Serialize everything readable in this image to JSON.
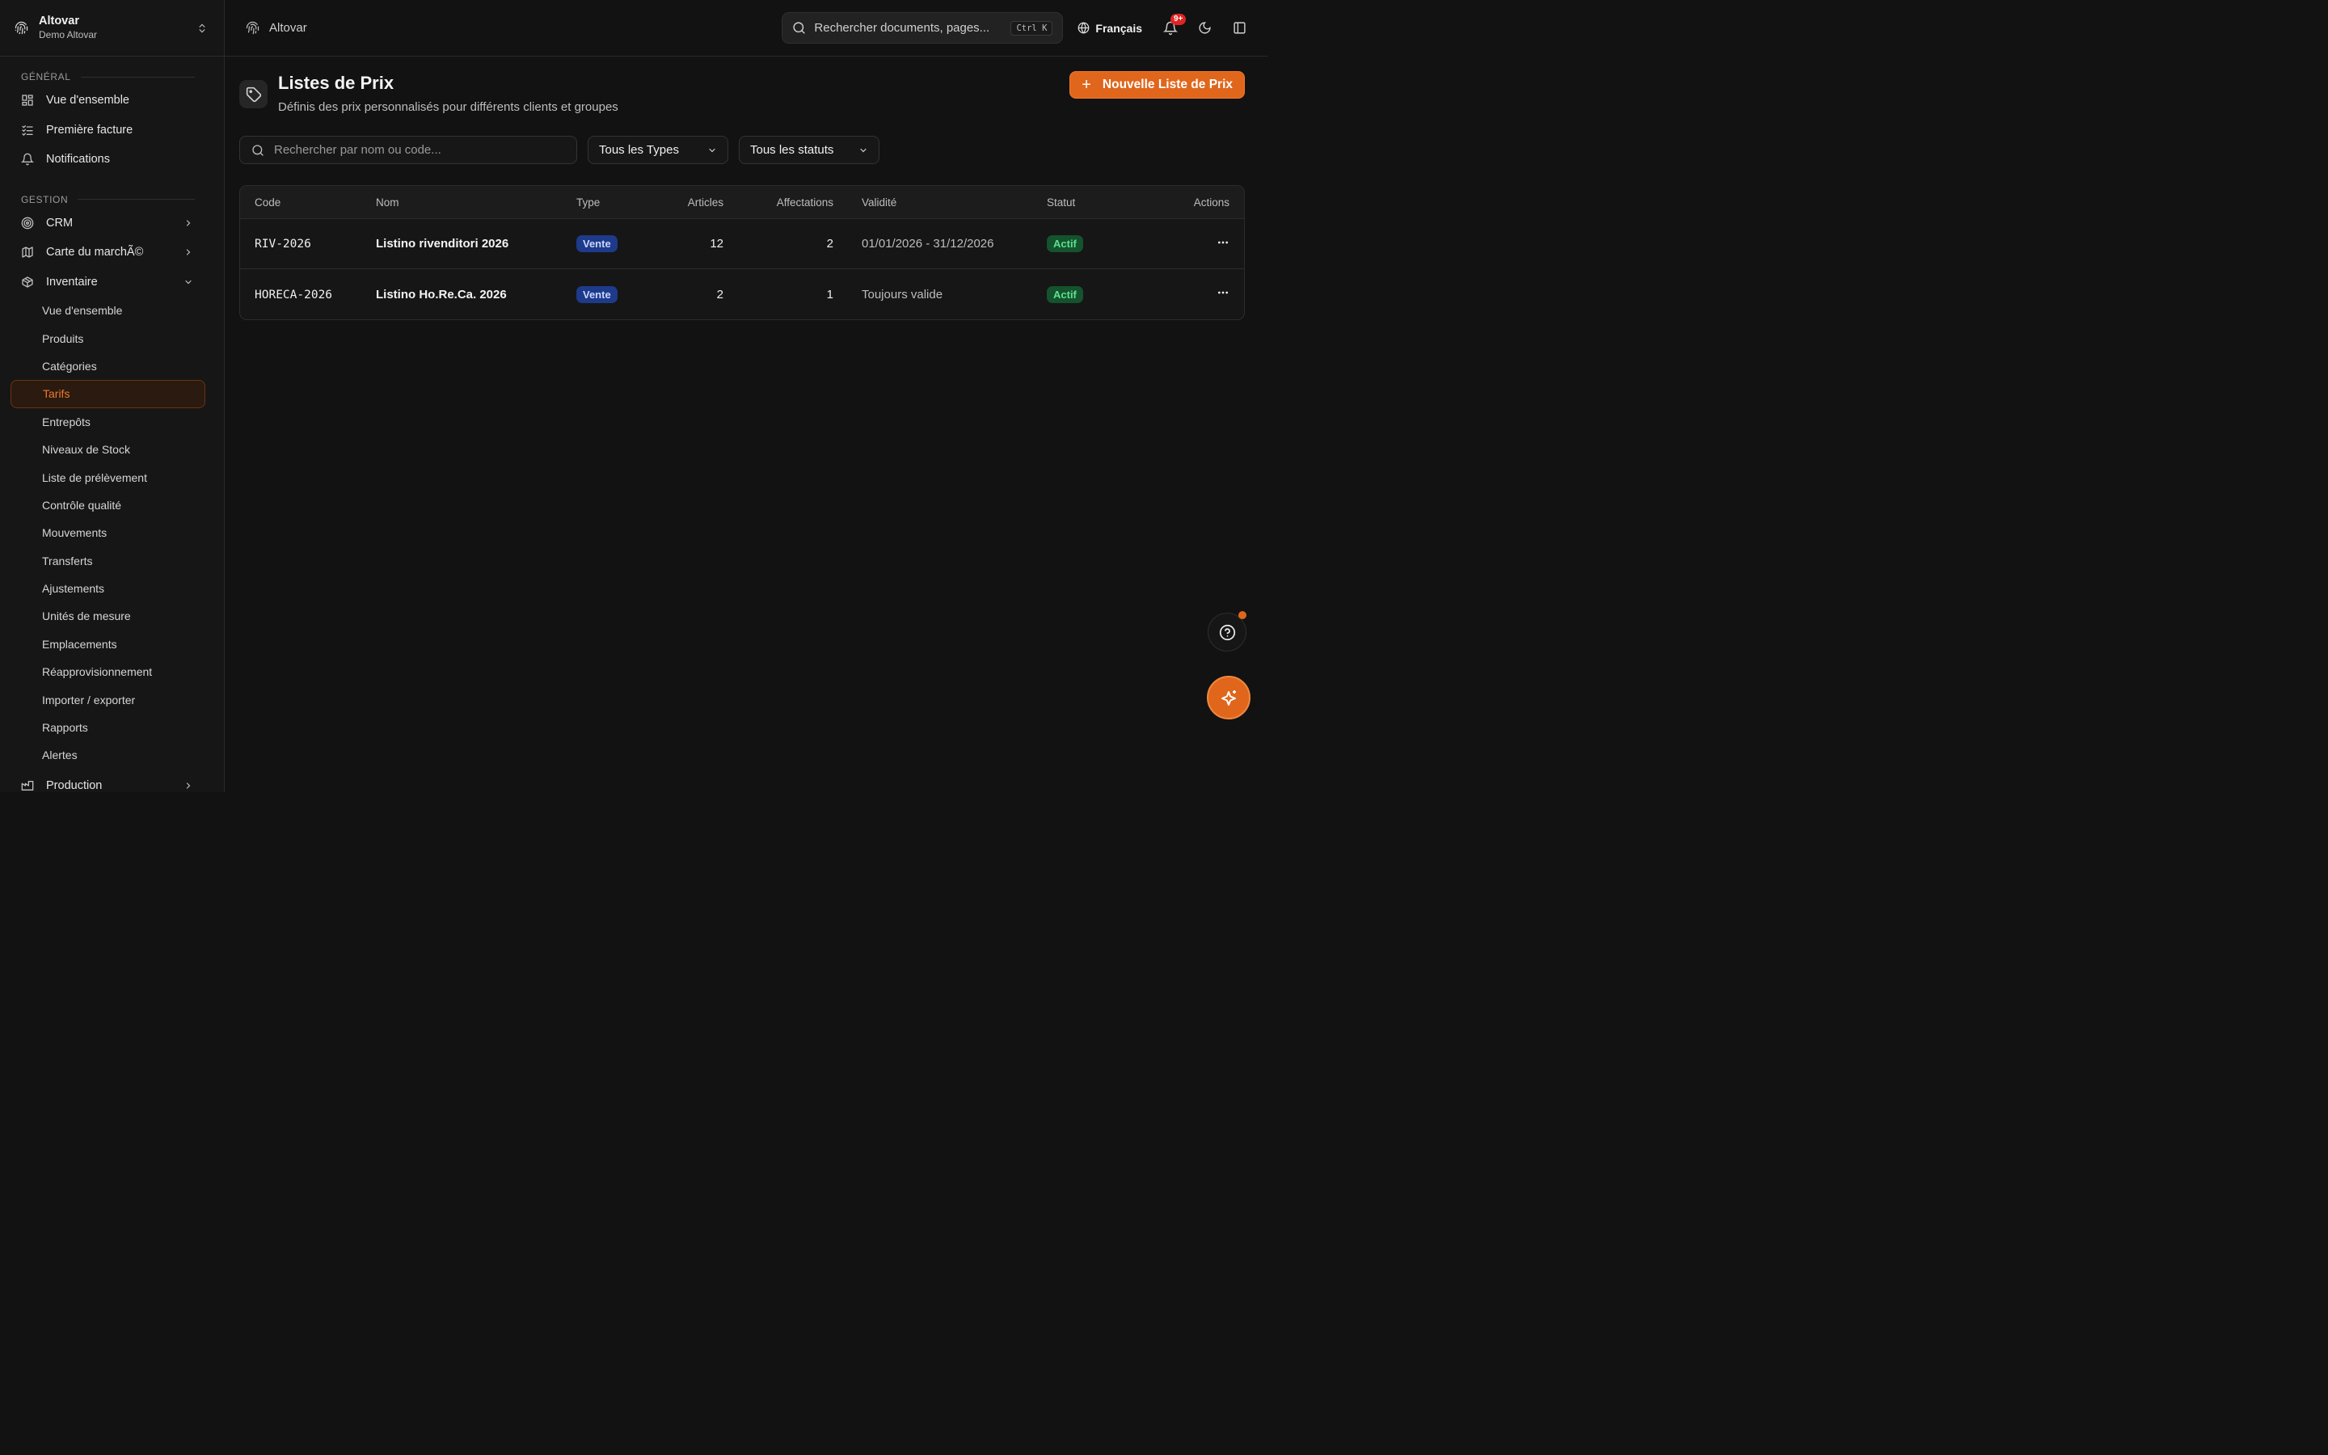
{
  "workspace": {
    "name": "Altovar",
    "subtitle": "Demo Altovar"
  },
  "sidebar": {
    "general_label": "GÉNÉRAL",
    "general_items": [
      {
        "label": "Vue d'ensemble",
        "icon": "dashboard-icon"
      },
      {
        "label": "Première facture",
        "icon": "checklist-icon"
      },
      {
        "label": "Notifications",
        "icon": "bell-icon"
      }
    ],
    "gestion_label": "GESTION",
    "gestion_items": [
      {
        "label": "CRM",
        "icon": "target-icon"
      },
      {
        "label": "Carte du marchÃ©",
        "icon": "map-icon"
      },
      {
        "label": "Inventaire",
        "icon": "box-icon"
      }
    ],
    "inventory_sub": [
      "Vue d'ensemble",
      "Produits",
      "Catégories",
      "Tarifs",
      "Entrepôts",
      "Niveaux de Stock",
      "Liste de prélèvement",
      "Contrôle qualité",
      "Mouvements",
      "Transferts",
      "Ajustements",
      "Unités de mesure",
      "Emplacements",
      "Réapprovisionnement",
      "Importer / exporter",
      "Rapports",
      "Alertes"
    ],
    "production": {
      "label": "Production",
      "icon": "factory-icon"
    },
    "active_item": "Tarifs"
  },
  "topbar": {
    "breadcrumb": "Altovar",
    "search_placeholder": "Rechercher documents, pages...",
    "shortcut": "Ctrl K",
    "language": "Français",
    "notification_count": "9+"
  },
  "page": {
    "title": "Listes de Prix",
    "subtitle": "Définis des prix personnalisés pour différents clients et groupes",
    "new_button": "Nouvelle Liste de Prix",
    "new_button_plus": "+"
  },
  "filters": {
    "search_placeholder": "Rechercher par nom ou code...",
    "type_select": "Tous les Types",
    "status_select": "Tous les statuts"
  },
  "table": {
    "headers": {
      "code": "Code",
      "nom": "Nom",
      "type": "Type",
      "articles": "Articles",
      "affectations": "Affectations",
      "validite": "Validité",
      "statut": "Statut",
      "actions": "Actions"
    },
    "rows": [
      {
        "code": "RIV-2026",
        "nom": "Listino rivenditori 2026",
        "type": "Vente",
        "articles": "12",
        "affectations": "2",
        "validite": "01/01/2026 - 31/12/2026",
        "statut": "Actif"
      },
      {
        "code": "HORECA-2026",
        "nom": "Listino Ho.Re.Ca. 2026",
        "type": "Vente",
        "articles": "2",
        "affectations": "1",
        "validite": "Toujours valide",
        "statut": "Actif"
      }
    ]
  },
  "colors": {
    "accent": "#e0661c",
    "background": "#121212",
    "badge_blue": "#1e3a8a",
    "badge_green": "#14532d",
    "notification": "#e02424"
  }
}
